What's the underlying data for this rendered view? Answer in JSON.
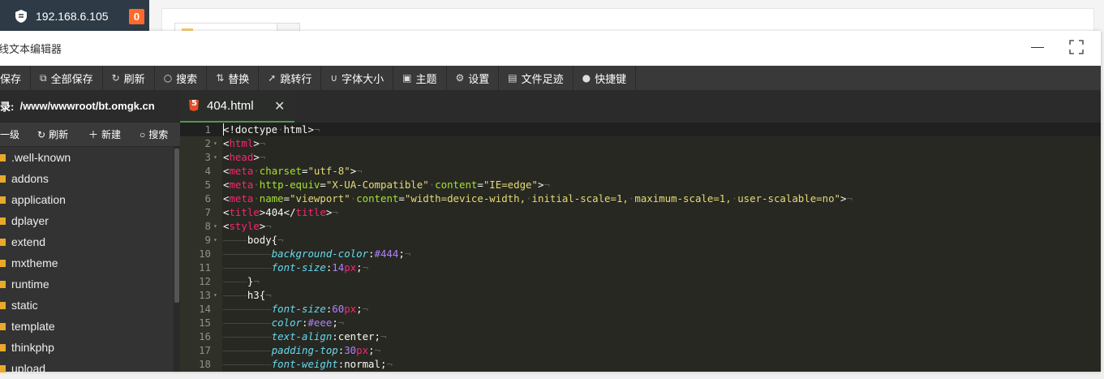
{
  "background": {
    "ip": "192.168.6.105",
    "badge": "0"
  },
  "window": {
    "title": "线文本编辑器"
  },
  "toolbar": {
    "items": [
      {
        "icon": "save-icon",
        "label": "保存"
      },
      {
        "icon": "save-all-icon",
        "label": "全部保存"
      },
      {
        "icon": "refresh-icon",
        "label": "刷新"
      },
      {
        "icon": "search-icon",
        "label": "搜索"
      },
      {
        "icon": "replace-icon",
        "label": "替换"
      },
      {
        "icon": "goto-line-icon",
        "label": "跳转行"
      },
      {
        "icon": "font-size-icon",
        "label": "字体大小"
      },
      {
        "icon": "theme-icon",
        "label": "主题"
      },
      {
        "icon": "settings-icon",
        "label": "设置"
      },
      {
        "icon": "history-icon",
        "label": "文件足迹"
      },
      {
        "icon": "help-icon",
        "label": "快捷键"
      }
    ]
  },
  "sidebar": {
    "path_label": "录:",
    "path": "/www/wwwroot/bt.omgk.cn",
    "tools": {
      "up": "一级",
      "refresh": "刷新",
      "new": "新建",
      "search": "搜索"
    },
    "folders": [
      ".well-known",
      "addons",
      "application",
      "dplayer",
      "extend",
      "mxtheme",
      "runtime",
      "static",
      "template",
      "thinkphp",
      "upload"
    ]
  },
  "tab": {
    "filename": "404.html"
  },
  "editor": {
    "line_numbers": [
      "1",
      "2",
      "3",
      "4",
      "5",
      "6",
      "7",
      "8",
      "9",
      "10",
      "11",
      "12",
      "13",
      "14",
      "15",
      "16",
      "17",
      "18"
    ]
  }
}
